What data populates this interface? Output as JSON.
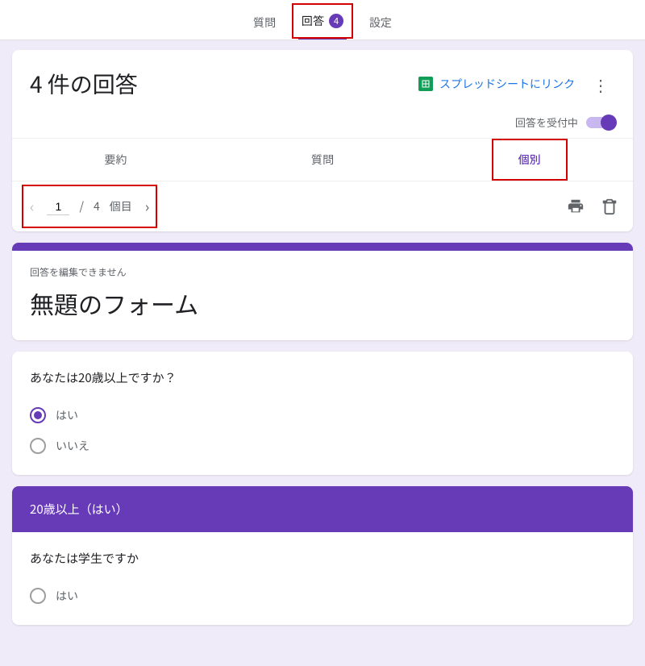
{
  "topTabs": {
    "questions": "質問",
    "responses": "回答",
    "responsesCount": "4",
    "settings": "設定"
  },
  "header": {
    "title": "4 件の回答",
    "sheetsLink": "スプレッドシートにリンク",
    "accepting": "回答を受付中"
  },
  "subtabs": {
    "summary": "要約",
    "question": "質問",
    "individual": "個別"
  },
  "pager": {
    "current": "1",
    "separator": "/",
    "total": "4",
    "suffix": "個目"
  },
  "formCard": {
    "cannotEdit": "回答を編集できません",
    "title": "無題のフォーム"
  },
  "q1": {
    "text": "あなたは20歳以上ですか？",
    "opt1": "はい",
    "opt2": "いいえ"
  },
  "section2": {
    "title": "20歳以上（はい）"
  },
  "q2": {
    "text": "あなたは学生ですか",
    "opt1": "はい"
  }
}
